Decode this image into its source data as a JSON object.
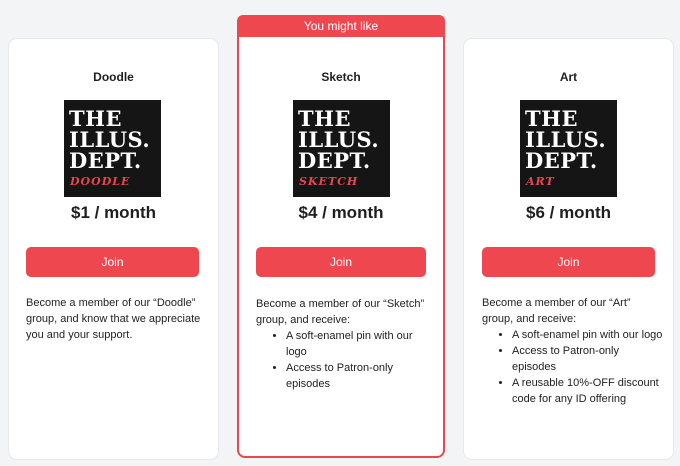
{
  "badge": "You might like",
  "tiers": [
    {
      "name": "Doodle",
      "cover": {
        "l1": "THE",
        "l2": "ILLUS.",
        "l3": "DEPT.",
        "sub": "DOODLE"
      },
      "price": "$1 / month",
      "button": "Join",
      "description": "Become a member of our “Doodle” group, and know that we appreciate you and your support.",
      "perks": []
    },
    {
      "name": "Sketch",
      "cover": {
        "l1": "THE",
        "l2": "ILLUS.",
        "l3": "DEPT.",
        "sub": "SKETCH"
      },
      "price": "$4 / month",
      "button": "Join",
      "description": "Become a member of our “Sketch” group, and receive:",
      "perks": [
        "A soft-enamel pin with our logo",
        "Access to Patron-only episodes"
      ]
    },
    {
      "name": "Art",
      "cover": {
        "l1": "THE",
        "l2": "ILLUS.",
        "l3": "DEPT.",
        "sub": "ART"
      },
      "price": "$6 / month",
      "button": "Join",
      "description": "Become a member of our “Art” group, and receive:",
      "perks": [
        "A soft-enamel pin with our logo",
        "Access to Patron-only episodes",
        "A reusable 10%-OFF discount code for any ID offering"
      ]
    }
  ],
  "colors": {
    "accent": "#ef474f",
    "background": "#f3f4f6",
    "card": "#ffffff",
    "cover": "#151515"
  }
}
